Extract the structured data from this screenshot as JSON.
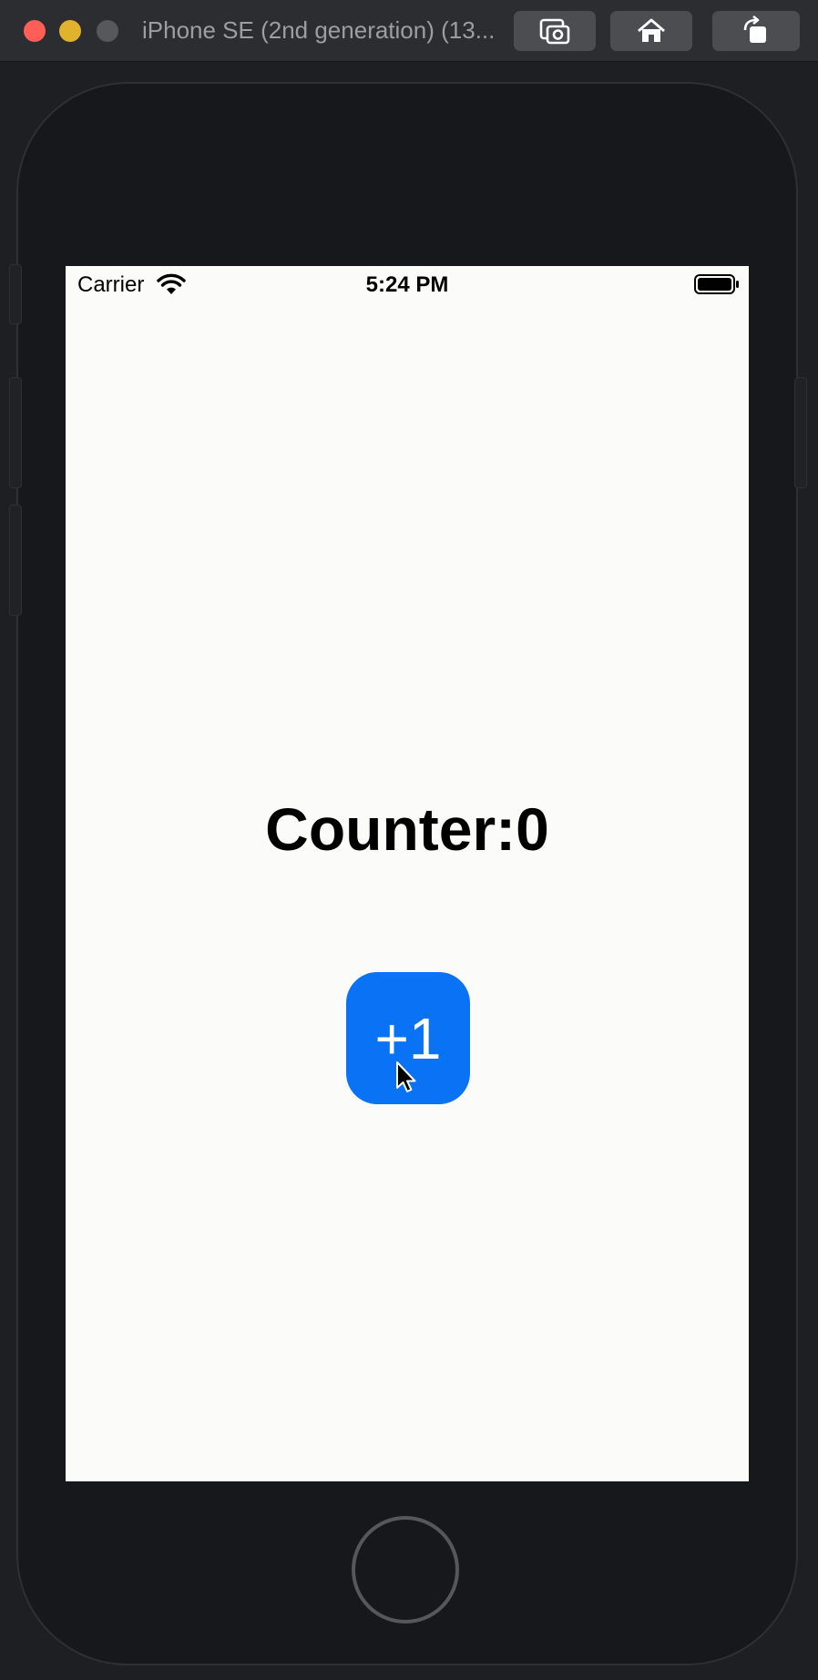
{
  "window": {
    "title": "iPhone SE (2nd generation) (13...",
    "controls": {
      "close": "close-button",
      "minimize": "minimize-button",
      "maximize": "maximize-button"
    },
    "toolbar": {
      "screenshot_icon": "camera-icon",
      "home_icon": "home-icon",
      "rotate_icon": "rotate-icon"
    }
  },
  "statusbar": {
    "carrier": "Carrier",
    "time": "5:24 PM",
    "wifi_icon": "wifi-icon",
    "battery_icon": "battery-icon"
  },
  "app": {
    "counter_text": "Counter:0",
    "button_label": "+1",
    "button_color": "#0a72f5"
  }
}
